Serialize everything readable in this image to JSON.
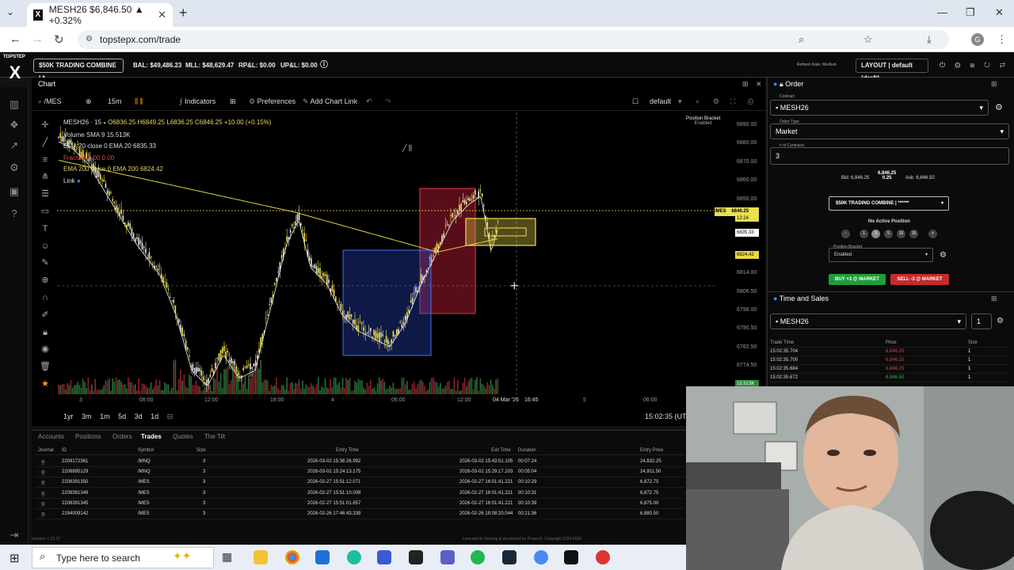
{
  "browser": {
    "tab_title": "MESH26 $6,846.50 ▲ +0.32%",
    "url": "topstepx.com/trade"
  },
  "topbar": {
    "account": "$50K TRADING COMBINE | *...",
    "bal": "BAL: $49,486.23",
    "mll": "MLL: $48,629.47",
    "rpl": "RP&L: $0.00",
    "upl": "UP&L: $0.00",
    "layout": "LAYOUT | default (draft)",
    "refresh": "Refresh Rate: Medium"
  },
  "chart": {
    "panel_label": "Chart",
    "symbol": "/MES",
    "interval": "15m",
    "indicators": "Indicators",
    "preferences": "Preferences",
    "add_link": "Add Chart Link",
    "template": "default",
    "title_line": "MESH26 · 15",
    "ohlc": "O6836.25 H6849.25 L6836.25 C6846.25 +10.00 (+0.15%)",
    "volume": "Volume SMA 9 15.513K",
    "ema20": "EMA 20 close 0 EMA 20 6835.33",
    "fractals": "Fractals 0.00 0.00",
    "ema200": "EMA 200 close 0 EMA 200 6824.42",
    "link": "Link",
    "position_bracket": "Position Bracket",
    "bracket_state": "Enabled",
    "price_ticks": [
      "6890.00",
      "6880.00",
      "6870.00",
      "6860.00",
      "6850.00",
      "6840.00",
      "6830.00",
      "6822.00",
      "6814.00",
      "6806.50",
      "6798.00",
      "6790.50",
      "6782.50",
      "6774.50",
      "6766.50"
    ],
    "price_labels": [
      "/MES",
      "6846.25",
      "12:24",
      "6835.33",
      "6824.42",
      "15.513K"
    ],
    "time_ticks": [
      "3",
      "06:00",
      "12:00",
      "18:00",
      "4",
      "06:00",
      "12:00",
      "04 Mar '26",
      "16:45",
      "5",
      "06:00"
    ],
    "timeframes": [
      "1yr",
      "3m",
      "1m",
      "5d",
      "3d",
      "1d"
    ],
    "clock": "15:02:35 (UTC"
  },
  "trades": {
    "tabs": [
      "Accounts",
      "Positions",
      "Orders",
      "Trades",
      "Quotes",
      "The Tilt"
    ],
    "headers": [
      "Journal",
      "ID",
      "Symbol",
      "Size",
      "Entry Time",
      "Exit Time",
      "Duration",
      "Entry Price"
    ],
    "rows": [
      [
        "2209172361",
        "/MNQ",
        "3",
        "2026-03-02 15:36:26.992",
        "2026-03-02 15:43:51.105",
        "00:07:24",
        "24,832.25"
      ],
      [
        "2208895129",
        "/MNQ",
        "3",
        "2026-03-02 15:24:13.175",
        "2026-03-02 15:29:17.203",
        "00:05:04",
        "24,911.50"
      ],
      [
        "2208391350",
        "/MES",
        "3",
        "2026-02-27 15:51:12.071",
        "2026-02-27 16:01:41.221",
        "00:10:29",
        "6,872.75"
      ],
      [
        "2208391349",
        "/MES",
        "3",
        "2026-02-27 15:51:10.008",
        "2026-02-27 16:01:41.221",
        "00:10:31",
        "6,872.75"
      ],
      [
        "2208391345",
        "/MES",
        "3",
        "2026-02-27 15:51:01.657",
        "2026-02-27 16:01:41.221",
        "00:10:39",
        "6,875.00"
      ],
      [
        "2194009142",
        "/MES",
        "3",
        "2026-02-26 17:46:43.339",
        "2026-02-26 18:08:20.044",
        "00:21:36",
        "6,880.50"
      ]
    ],
    "version": "Version: 1.22.37",
    "license": "Licensed to Topstep & developed by ProjectX. Copyright 2024-2026"
  },
  "order": {
    "title": "Order",
    "contract_label": "Contract",
    "contract": "MESH26",
    "type_label": "Order Type",
    "type": "Market",
    "qty_label": "# of Contracts",
    "qty": "3",
    "bid": "Bid: 6,846.25",
    "last": "6,846.25",
    "spread": "0.25",
    "ask": "Ask: 6,846.50",
    "account": "$50K TRADING COMBINE | ******",
    "no_position": "No Active Position",
    "counts": [
      "-",
      "1",
      "3",
      "5",
      "10",
      "15",
      "+"
    ],
    "bracket_label": "Position Bracket",
    "bracket": "Enabled",
    "buy": "BUY +3 @ MARKET",
    "sell": "SELL -3 @ MARKET"
  },
  "tas": {
    "title": "Time and Sales",
    "contract": "MESH26",
    "size": "1",
    "headers": [
      "Trade Time",
      "Price",
      "Size"
    ],
    "rows": [
      [
        "15:02:35.704",
        "6,846.25",
        "1"
      ],
      [
        "15:02:35.700",
        "6,846.25",
        "1"
      ],
      [
        "15:02:35.684",
        "6,846.25",
        "1"
      ],
      [
        "15:02:35.672",
        "6,846.50",
        "1"
      ]
    ]
  },
  "taskbar": {
    "search": "Type here to search"
  },
  "colors": {
    "accent": "#f5e642",
    "buy": "#1f9d3a",
    "sell": "#c42b2b",
    "up": "#f3e24a",
    "down": "#e6e6e6"
  }
}
